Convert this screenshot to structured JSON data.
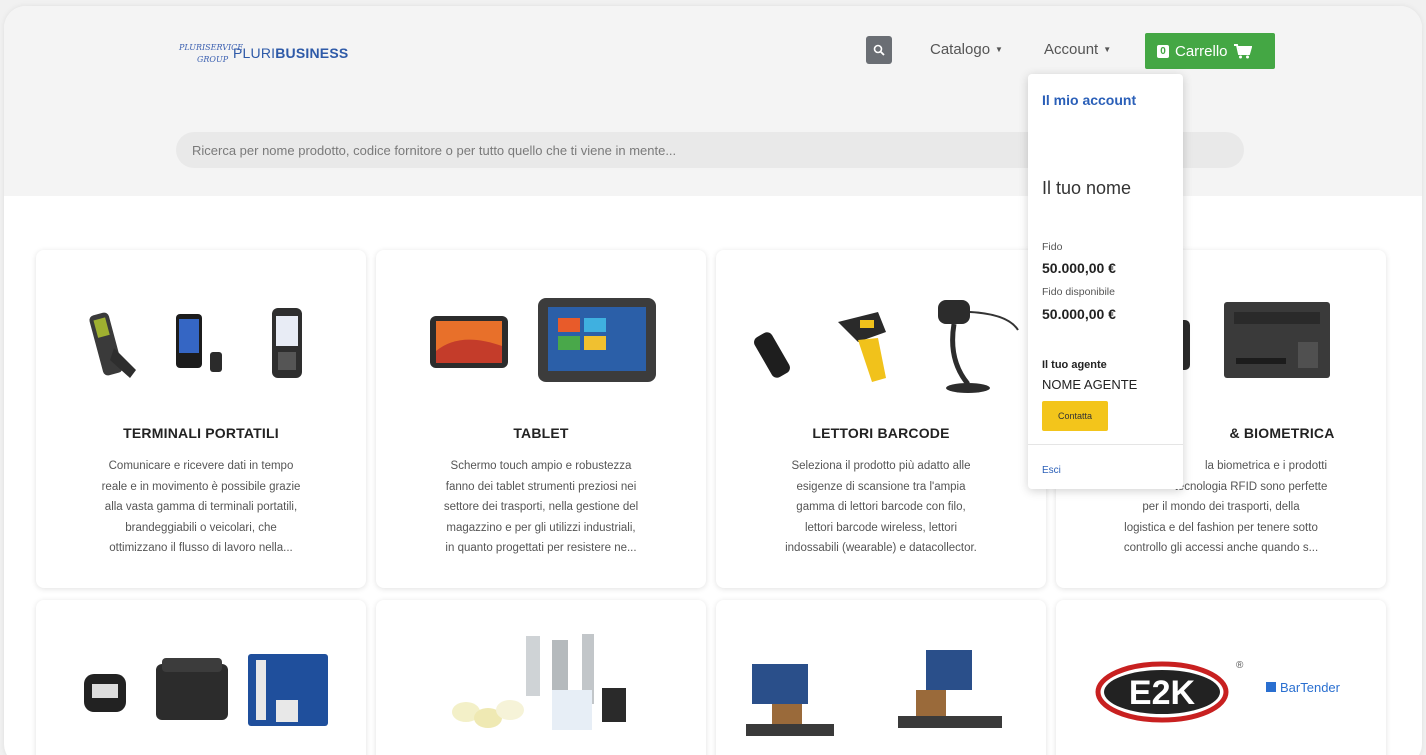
{
  "header": {
    "logo_text_light": "PLURI",
    "logo_text_bold": "BUSINESS",
    "logo_mark_words": [
      "PLURISERVICE",
      "GROUP"
    ],
    "nav": {
      "catalog": "Catalogo",
      "account": "Account"
    },
    "cart": {
      "count": "0",
      "label": "Carrello"
    }
  },
  "search": {
    "placeholder": "Ricerca per nome prodotto, codice fornitore o per tutto quello che ti viene in mente..."
  },
  "account_menu": {
    "my_account": "Il mio account",
    "name": "Il tuo nome",
    "credit_label": "Fido",
    "credit_value": "50.000,00 €",
    "available_label": "Fido disponibile",
    "available_value": "50.000,00 €",
    "agent_label": "Il tuo agente",
    "agent_name": "NOME AGENTE",
    "contact_button": "Contatta",
    "logout": "Esci"
  },
  "categories": [
    {
      "title": "TERMINALI PORTATILI",
      "lines": [
        "Comunicare e ricevere dati in tempo",
        "reale e in movimento è possibile grazie",
        "alla vasta gamma di terminali portatili,",
        "brandeggiabili o veicolari, che",
        "ottimizzano il flusso di lavoro nella..."
      ]
    },
    {
      "title": "TABLET",
      "lines": [
        "Schermo touch ampio e robustezza",
        "fanno dei tablet strumenti preziosi nei",
        "settore dei trasporti, nella gestione del",
        "magazzino e per gli utilizzi industriali,",
        "in quanto progettati per resistere ne..."
      ]
    },
    {
      "title": "LETTORI BARCODE",
      "lines": [
        "Seleziona il prodotto più adatto alle",
        "esigenze di scansione tra l'ampia",
        "gamma di lettori barcode con filo,",
        "lettori barcode wireless, lettori",
        "indossabili (wearable) e datacollector."
      ]
    },
    {
      "title": "& BIOMETRICA",
      "lines": [
        "la biometrica e i prodotti",
        "tecnologia RFID sono perfette",
        "per il mondo dei trasporti, della",
        "logistica e del fashion per tenere sotto",
        "controllo gli accessi anche quando s..."
      ]
    }
  ],
  "brand_logos": {
    "e2k": "E2K",
    "bartender": "BarTender"
  },
  "colors": {
    "accent_blue": "#2a5fb8",
    "cart_green": "#44a744",
    "contact_yellow": "#f3c51b",
    "search_button": "#6a6e74"
  }
}
